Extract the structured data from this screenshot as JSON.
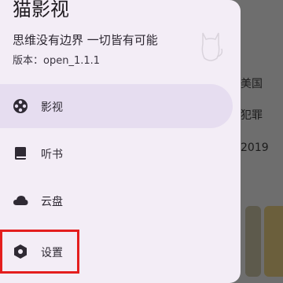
{
  "drawer": {
    "title": "猫影视",
    "slogan": "思维没有边界 一切皆有可能",
    "version": "版本：open_1.1.1",
    "items": [
      {
        "label": "影视",
        "icon": "film-reel-icon",
        "selected": true
      },
      {
        "label": "听书",
        "icon": "book-icon",
        "selected": false
      },
      {
        "label": "云盘",
        "icon": "cloud-icon",
        "selected": false
      },
      {
        "label": "设置",
        "icon": "settings-icon",
        "selected": false
      }
    ]
  },
  "background": {
    "tags": [
      "美国",
      "犯罪",
      "2019"
    ]
  },
  "colors": {
    "drawer_bg": "#f3edf6",
    "selected_bg": "#e6ddf0",
    "highlight": "#e41e1e",
    "scrim": "#707070"
  }
}
